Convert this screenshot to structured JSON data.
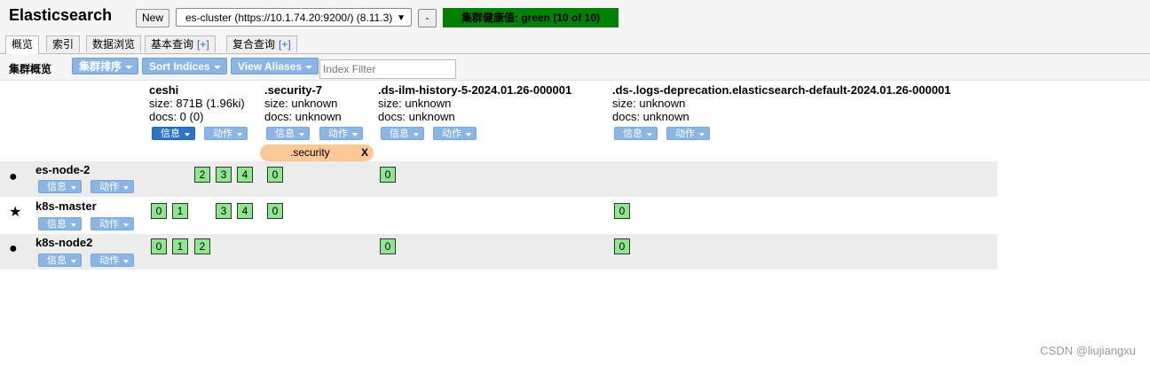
{
  "header": {
    "title": "Elasticsearch",
    "new_label": "New",
    "cluster_select": "es-cluster (https://10.1.74.20:9200/) (8.11.3)",
    "minus_label": "-",
    "health": "集群健康值: green (10 of 10)"
  },
  "tabs": [
    {
      "label": "概览"
    },
    {
      "label": "索引"
    },
    {
      "label": "数据浏览"
    },
    {
      "label": "基本查询",
      "plus": "[+]"
    },
    {
      "label": "复合查询",
      "plus": "[+]"
    }
  ],
  "toolbar": {
    "label": "集群概览",
    "sort_cluster": "集群排序",
    "sort_indices": "Sort Indices",
    "view_aliases": "View Aliases",
    "index_filter_placeholder": "Index Filter"
  },
  "dropdowns": {
    "info": "信息",
    "action": "动作"
  },
  "indices": [
    {
      "name": "ceshi",
      "size": "size: 871B (1.96ki)",
      "docs": "docs: 0 (0)"
    },
    {
      "name": ".security-7",
      "size": "size: unknown",
      "docs": "docs: unknown"
    },
    {
      "name": ".ds-ilm-history-5-2024.01.26-000001",
      "size": "size: unknown",
      "docs": "docs: unknown"
    },
    {
      "name": ".ds-.logs-deprecation.elasticsearch-default-2024.01.26-000001",
      "size": "size: unknown",
      "docs": "docs: unknown"
    }
  ],
  "alias": {
    "name": ".security",
    "close": "X"
  },
  "nodes": [
    {
      "name": "es-node-2",
      "icon": "circle-icon",
      "symbol": "●",
      "shards": {
        "ceshi": [
          "2",
          "3",
          "4"
        ],
        "security": [
          "0"
        ],
        "ilm": [
          "0"
        ],
        "logs": []
      }
    },
    {
      "name": "k8s-master",
      "icon": "star-icon",
      "symbol": "★",
      "shards": {
        "ceshi": [
          "0",
          "1",
          "3",
          "4"
        ],
        "security": [
          "0"
        ],
        "ilm": [],
        "logs": [
          "0"
        ]
      }
    },
    {
      "name": "k8s-node2",
      "icon": "circle-icon",
      "symbol": "●",
      "shards": {
        "ceshi": [
          "0",
          "1",
          "2"
        ],
        "security": [],
        "ilm": [
          "0"
        ],
        "logs": [
          "0"
        ]
      }
    }
  ],
  "watermark": "CSDN @liujiangxu",
  "colors": {
    "health_green": "#008000",
    "shard_green": "#8ee78e",
    "alias_orange": "#fbc896",
    "button_blue": "#8bb5e3"
  }
}
